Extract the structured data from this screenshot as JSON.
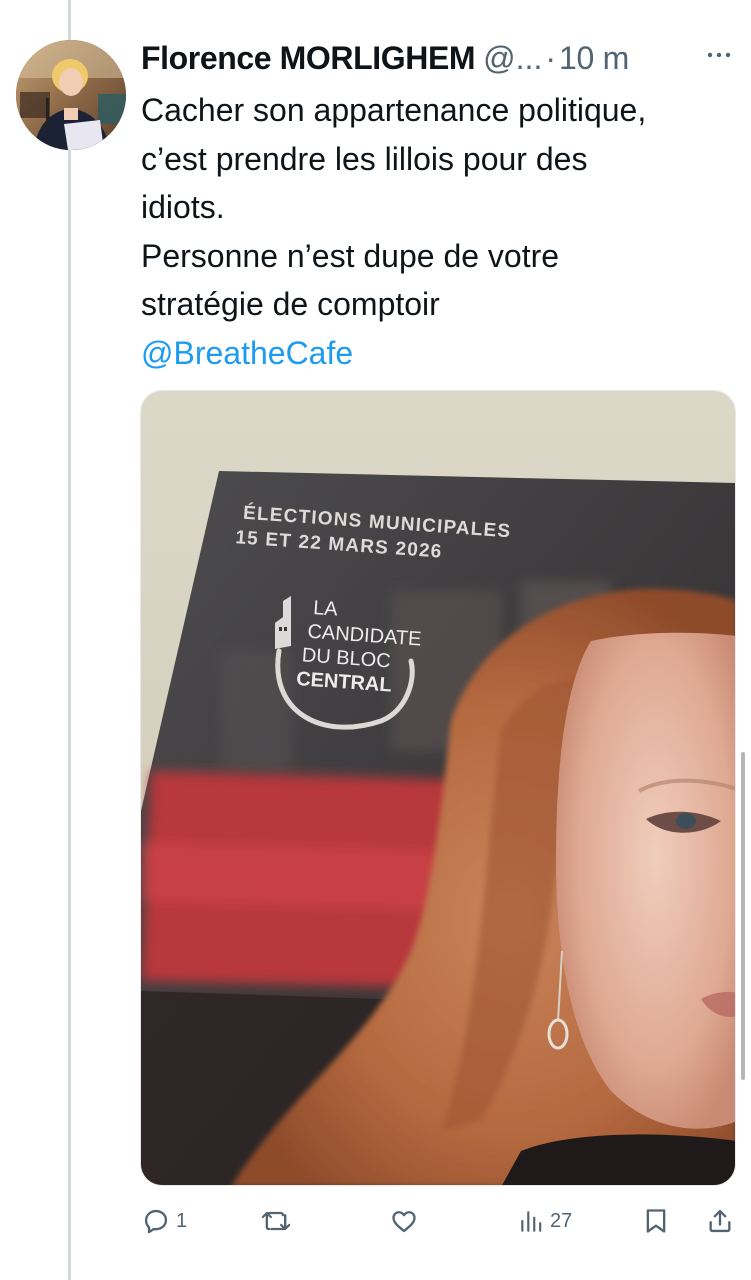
{
  "tweet": {
    "author": {
      "display_name": "Florence MORLIGHEM",
      "handle": "@...",
      "avatar_icon": "avatar"
    },
    "separator": "·",
    "time": "10 m",
    "more_icon": "more-dots-icon",
    "text_lines": [
      "Cacher son appartenance politique,",
      "c’est prendre les lillois pour des",
      "idiots.",
      "Personne n’est dupe de votre",
      "stratégie de comptoir"
    ],
    "mention": "@BreatheCafe",
    "media": {
      "poster_heading_line1": "ÉLECTIONS MUNICIPALES",
      "poster_heading_line2": "15 ET 22 MARS 2026",
      "logo_line1": "LA",
      "logo_line2": "CANDIDATE",
      "logo_line3": "DU BLOC",
      "logo_line4": "CENTRAL"
    },
    "actions": {
      "reply_icon": "reply-icon",
      "reply_count": "1",
      "retweet_icon": "retweet-icon",
      "like_icon": "heart-icon",
      "views_icon": "views-chart-icon",
      "views_count": "27",
      "bookmark_icon": "bookmark-icon",
      "share_icon": "share-icon"
    }
  },
  "colors": {
    "text": "#0f1419",
    "secondary": "#536471",
    "link": "#1d9bf0",
    "thread_line": "#cfd9de"
  }
}
